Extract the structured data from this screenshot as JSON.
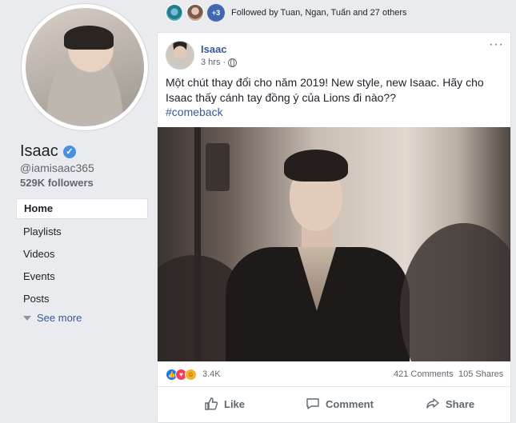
{
  "profile": {
    "name": "Isaac",
    "handle": "@iamisaac365",
    "followers": "529K followers"
  },
  "nav": {
    "items": [
      {
        "label": "Home"
      },
      {
        "label": "Playlists"
      },
      {
        "label": "Videos"
      },
      {
        "label": "Events"
      },
      {
        "label": "Posts"
      }
    ],
    "see_more": "See more"
  },
  "followed": {
    "more_count": "+3",
    "text": "Followed by Tuan, Ngan, Tuấn and 27 others"
  },
  "post": {
    "author": "Isaac",
    "time": "3 hrs ·",
    "text": "Một chút thay đổi cho năm 2019! New style, new Isaac. Hãy cho Isaac thấy cánh tay đồng ý của Lions đi nào??",
    "hashtag": "#comeback",
    "more": "···",
    "reactions_count": "3.4K",
    "comments": "421 Comments",
    "shares": "105 Shares",
    "actions": {
      "like": "Like",
      "comment": "Comment",
      "share": "Share"
    }
  },
  "colors": {
    "link": "#385898",
    "page_bg": "#e9ebee",
    "verified": "#4a90e2",
    "like_blue": "#1877f2",
    "love_red": "#f33e58"
  }
}
